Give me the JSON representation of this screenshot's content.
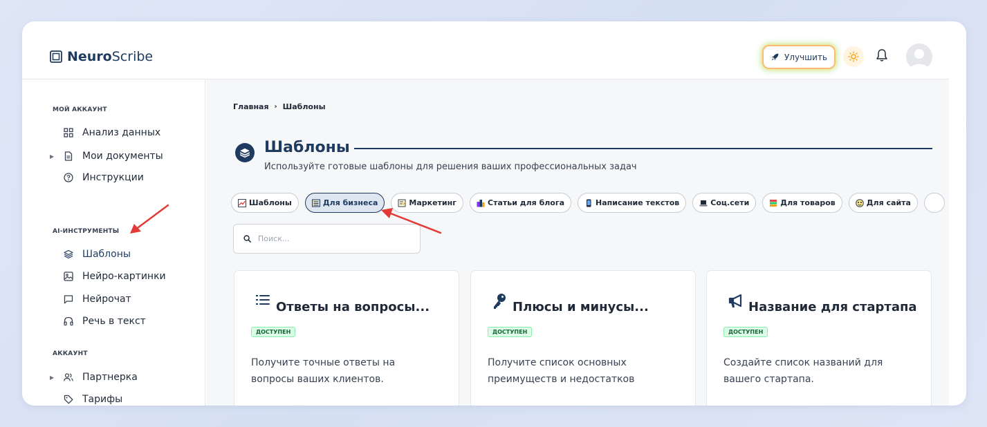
{
  "app": {
    "logo_bold": "Neuro",
    "logo_light": "Scribe"
  },
  "header": {
    "upgrade_label": "Улучшить"
  },
  "sidebar": {
    "sections": [
      {
        "title": "МОЙ АККАУНТ"
      },
      {
        "title": "AI-ИНСТРУМЕНТЫ"
      },
      {
        "title": "АККАУНТ"
      }
    ],
    "items": [
      {
        "label": "Анализ данных",
        "icon": "grid-icon"
      },
      {
        "label": "Мои документы",
        "icon": "document-icon"
      },
      {
        "label": "Инструкции",
        "icon": "help-circle-icon"
      },
      {
        "label": "Шаблоны",
        "icon": "layers-icon",
        "active": true
      },
      {
        "label": "Нейро-картинки",
        "icon": "image-icon"
      },
      {
        "label": "Нейрочат",
        "icon": "chat-icon"
      },
      {
        "label": "Речь в текст",
        "icon": "headphones-icon"
      },
      {
        "label": "Партнерка",
        "icon": "users-icon"
      },
      {
        "label": "Тарифы",
        "icon": "tag-icon"
      }
    ]
  },
  "breadcrumb": {
    "home": "Главная",
    "current": "Шаблоны"
  },
  "page": {
    "title": "Шаблоны",
    "subtitle": "Используйте готовые шаблоны для решения ваших профессиональных задач"
  },
  "chips": [
    {
      "label": "Шаблоны"
    },
    {
      "label": "Для бизнеса",
      "active": true
    },
    {
      "label": "Маркетинг"
    },
    {
      "label": "Статьи для блога"
    },
    {
      "label": "Написание текстов"
    },
    {
      "label": "Соц.сети"
    },
    {
      "label": "Для товаров"
    },
    {
      "label": "Для сайта"
    }
  ],
  "search": {
    "placeholder": "Поиск..."
  },
  "cards": [
    {
      "title": "Ответы на вопросы...",
      "badge": "ДОСТУПЕН",
      "desc": "Получите точные ответы на вопросы ваших клиентов."
    },
    {
      "title": "Плюсы и минусы...",
      "badge": "ДОСТУПЕН",
      "desc": "Получите список основных преимуществ и недостатков"
    },
    {
      "title": "Название для стартапа",
      "badge": "ДОСТУПЕН",
      "desc": "Создайте список названий для вашего стартапа."
    }
  ],
  "colors": {
    "accent": "#1e3a5f",
    "annotation_arrow": "#e53935",
    "badge_bg": "#dcfce7"
  }
}
